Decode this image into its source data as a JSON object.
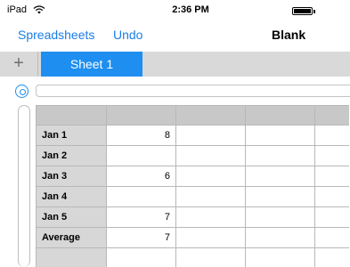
{
  "status_bar": {
    "device": "iPad",
    "time": "2:36 PM"
  },
  "nav": {
    "back_label": "Spreadsheets",
    "undo_label": "Undo",
    "title": "Blank"
  },
  "tabs": {
    "add_label": "+",
    "sheets": [
      {
        "label": "Sheet 1",
        "active": true
      }
    ]
  },
  "formula_bar": {
    "value": ""
  },
  "grid": {
    "rows": [
      {
        "label": "Jan 1",
        "value": "8"
      },
      {
        "label": "Jan 2",
        "value": ""
      },
      {
        "label": "Jan 3",
        "value": "6"
      },
      {
        "label": "Jan 4",
        "value": ""
      },
      {
        "label": "Jan 5",
        "value": "7"
      },
      {
        "label": "Average",
        "value": "7"
      },
      {
        "label": "",
        "value": ""
      }
    ]
  },
  "colors": {
    "accent": "#1e8ef0",
    "link": "#1a7ee6",
    "header_fill": "#c8c8c8",
    "label_fill": "#d7d7d7"
  }
}
